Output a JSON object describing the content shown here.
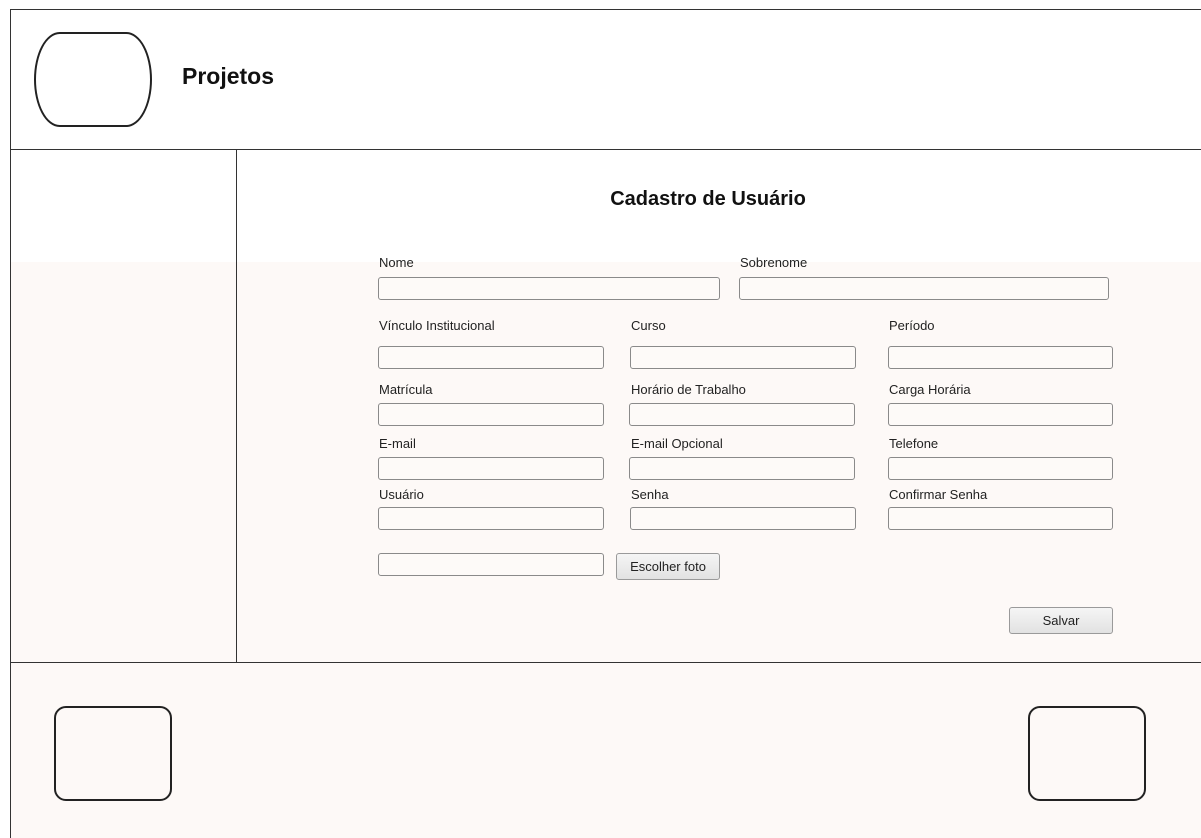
{
  "header": {
    "title": "Projetos"
  },
  "form": {
    "title": "Cadastro de Usuário",
    "fields": {
      "nome": {
        "label": "Nome",
        "value": ""
      },
      "sobrenome": {
        "label": "Sobrenome",
        "value": ""
      },
      "vinculo": {
        "label": "Vínculo Institucional",
        "value": ""
      },
      "curso": {
        "label": "Curso",
        "value": ""
      },
      "periodo": {
        "label": "Período",
        "value": ""
      },
      "matricula": {
        "label": "Matrícula",
        "value": ""
      },
      "horario": {
        "label": "Horário de Trabalho",
        "value": ""
      },
      "carga": {
        "label": "Carga Horária",
        "value": ""
      },
      "email": {
        "label": "E-mail",
        "value": ""
      },
      "email_opcional": {
        "label": "E-mail Opcional",
        "value": ""
      },
      "telefone": {
        "label": "Telefone",
        "value": ""
      },
      "usuario": {
        "label": "Usuário",
        "value": ""
      },
      "senha": {
        "label": "Senha",
        "value": ""
      },
      "confirmar_senha": {
        "label": "Confirmar Senha",
        "value": ""
      },
      "foto": {
        "value": ""
      }
    },
    "choose_photo_label": "Escolher foto",
    "save_label": "Salvar"
  }
}
